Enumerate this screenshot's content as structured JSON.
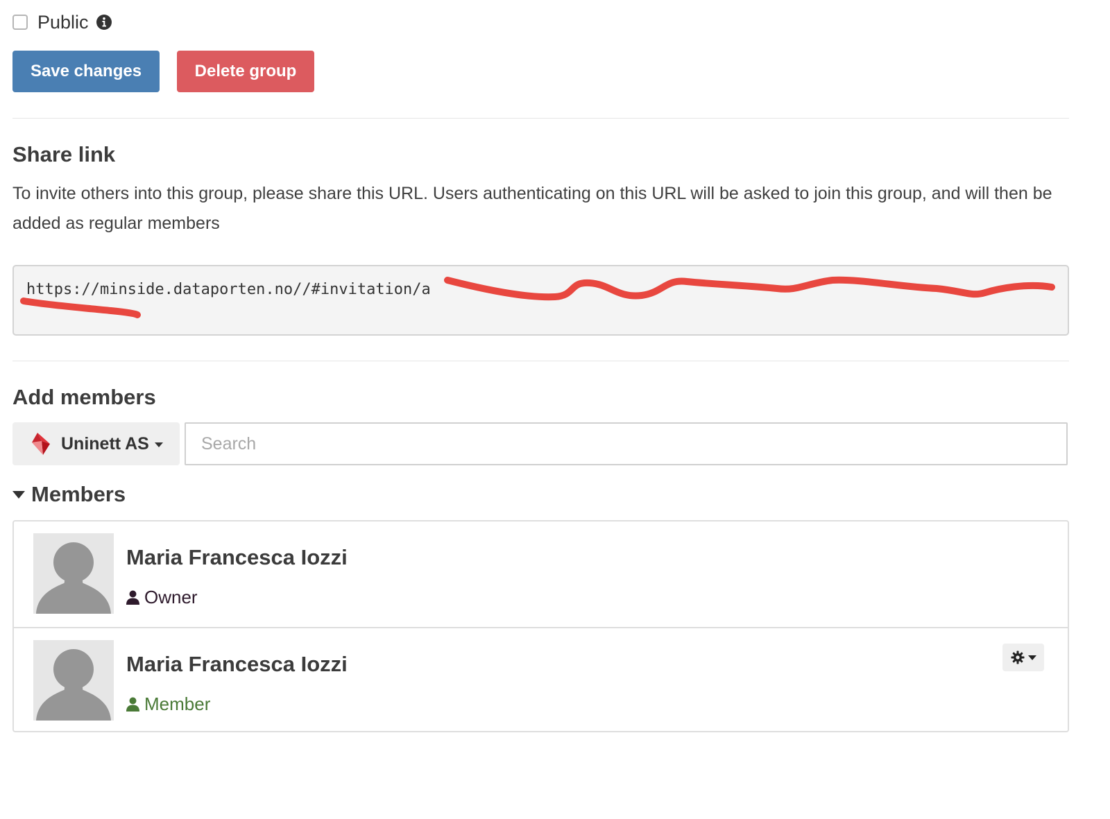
{
  "settings": {
    "public_label": "Public",
    "public_checked": false,
    "save_label": "Save changes",
    "delete_label": "Delete group"
  },
  "share_link": {
    "title": "Share link",
    "description": "To invite others into this group, please share this URL. Users authenticating on this URL will be asked to join this group, and will then be added as regular members",
    "url_visible": "https://minside.dataporten.no//#invitation/a",
    "url_obscured_note": "remainder of URL scribbled out in red"
  },
  "add_members": {
    "title": "Add members",
    "org_label": "Uninett AS",
    "search_placeholder": "Search",
    "search_value": ""
  },
  "members": {
    "title": "Members",
    "list": [
      {
        "name": "Maria Francesca Iozzi",
        "role": "Owner",
        "role_color": "#2e1a2c",
        "has_settings": false
      },
      {
        "name": "Maria Francesca Iozzi",
        "role": "Member",
        "role_color": "#4a7a37",
        "has_settings": true
      }
    ]
  },
  "colors": {
    "primary": "#4a7fb3",
    "danger": "#dc5b5f",
    "scribble": "#e8473f"
  },
  "icons": [
    "info-icon",
    "uninett-logo-icon",
    "caret-down-icon",
    "user-icon",
    "gear-icon",
    "avatar-placeholder-icon"
  ]
}
